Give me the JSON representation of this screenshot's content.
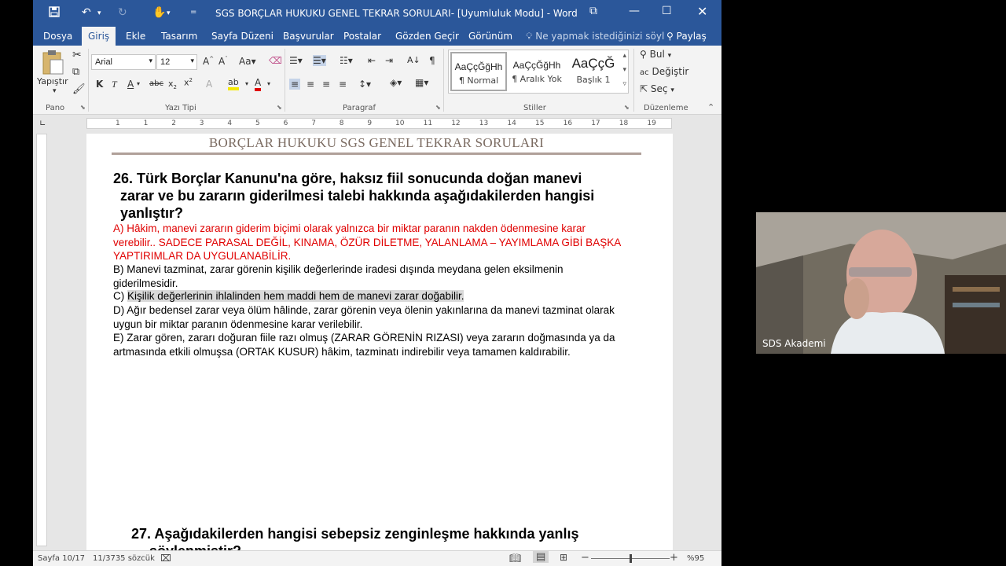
{
  "titlebar": {
    "title": "SGS BORÇLAR HUKUKU GENEL TEKRAR SORULARI- [Uyumluluk Modu] - Word"
  },
  "tabs": [
    "Dosya",
    "Giriş",
    "Ekle",
    "Tasarım",
    "Sayfa Düzeni",
    "Başvurular",
    "Postalar",
    "Gözden Geçir",
    "Görünüm"
  ],
  "tell_me": "Ne yapmak istediğinizi söyl",
  "share": "Paylaş",
  "ribbon": {
    "paste": "Yapıştır",
    "font_name": "Arial",
    "font_size": "12",
    "groups": [
      "Pano",
      "Yazı Tipi",
      "Paragraf",
      "Stiller",
      "Düzenleme"
    ],
    "styles": [
      {
        "sample": "AaÇçĞğHh",
        "name": "¶ Normal"
      },
      {
        "sample": "AaÇçĞğHh",
        "name": "¶ Aralık Yok"
      },
      {
        "sample": "AaÇçĞ",
        "name": "Başlık 1"
      }
    ],
    "find": "Bul",
    "replace": "Değiştir",
    "select": "Seç"
  },
  "ruler_numbers": [
    "1",
    "1",
    "2",
    "3",
    "4",
    "5",
    "6",
    "7",
    "8",
    "9",
    "10",
    "11",
    "12",
    "13",
    "14",
    "15",
    "16",
    "17",
    "18",
    "19"
  ],
  "document": {
    "header": "BORÇLAR HUKUKU SGS GENEL TEKRAR SORULARI",
    "q26_line1": "26.   Türk Borçlar Kanunu'na göre, haksız fiil sonucunda doğan manevi",
    "q26_line2": "zarar ve bu zararın giderilmesi talebi hakkında aşağıdakilerden hangisi",
    "q26_line3": "yanlıştır?",
    "optA": "A)   Hâkim, manevi zararın giderim biçimi olarak yalnızca bir miktar paranın nakden ödenmesine karar verebilir.. SADECE PARASAL DEĞİL, KINAMA, ÖZÜR DİLETME, YALANLAMA – YAYIMLAMA GİBİ BAŞKA YAPTIRIMLAR DA UYGULANABİLİR.",
    "optB": "B)   Manevi tazminat, zarar görenin kişilik değerlerinde iradesi dışında meydana gelen eksilmenin giderilmesidir.",
    "optC_prefix": "C)   ",
    "optC_text": "Kişilik değerlerinin ihlalinden hem maddi hem de manevi zarar doğabilir.",
    "optD": "D)   Ağır bedensel zarar veya ölüm hâlinde, zarar görenin veya ölenin yakınlarına da manevi tazminat olarak uygun bir miktar paranın ödenmesine karar verilebilir.",
    "optE": "E)   Zarar gören, zararı doğuran fiile razı olmuş (ZARAR GÖRENİN RIZASI) veya zararın doğmasında ya da artmasında etkili olmuşsa (ORTAK KUSUR) hâkim, tazminatı indirebilir veya tamamen kaldırabilir.",
    "q27": "27.       Aşağıdakilerden hangisi sebepsiz zenginleşme hakkında yanlış",
    "q27_cut": "söylenmiştir?"
  },
  "statusbar": {
    "page": "Sayfa 10/17",
    "words": "11/3735 sözcük",
    "zoom": "%95"
  },
  "zoom_level": 0.5,
  "video": {
    "label": "SDS Akademi"
  },
  "colors": {
    "word_blue": "#2b579a",
    "red_text": "#e00000"
  }
}
